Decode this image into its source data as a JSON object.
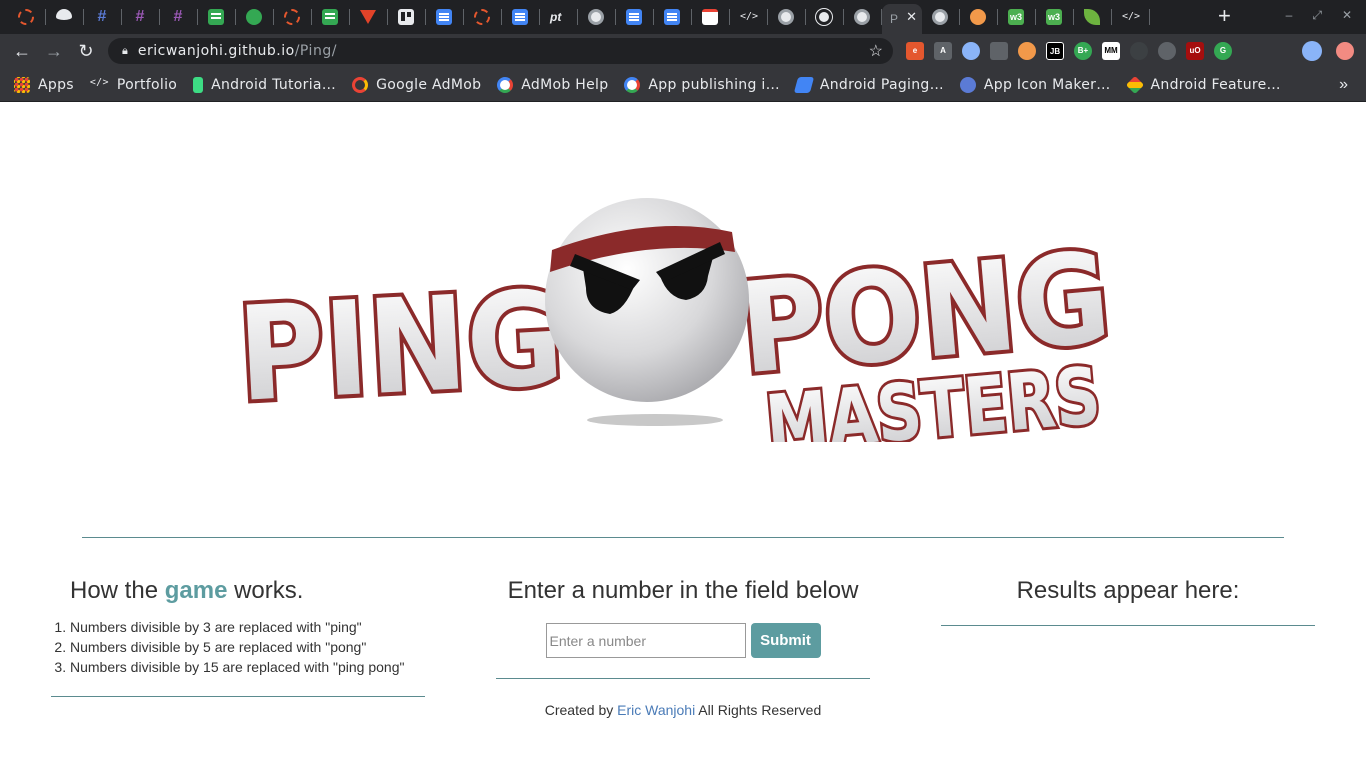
{
  "browser": {
    "tabs": [
      {
        "icon": "ubuntu-ring-icon"
      },
      {
        "icon": "helmet-icon"
      },
      {
        "icon": "slack-icon"
      },
      {
        "icon": "slack-icon"
      },
      {
        "icon": "slack-icon"
      },
      {
        "icon": "sheets-icon"
      },
      {
        "icon": "chat-icon"
      },
      {
        "icon": "ubuntu-ring-icon"
      },
      {
        "icon": "sheets-icon"
      },
      {
        "icon": "gitlab-icon"
      },
      {
        "icon": "trello-icon"
      },
      {
        "icon": "docs-icon"
      },
      {
        "icon": "ubuntu-ring-icon"
      },
      {
        "icon": "docs-icon"
      },
      {
        "icon": "pivotal-icon"
      },
      {
        "icon": "globe-icon"
      },
      {
        "icon": "docs-icon"
      },
      {
        "icon": "docs-icon"
      },
      {
        "icon": "gmail-icon"
      },
      {
        "icon": "code-icon"
      },
      {
        "icon": "globe-icon"
      },
      {
        "icon": "github-icon"
      },
      {
        "icon": "globe-icon"
      }
    ],
    "active_tab": {
      "label": "P"
    },
    "tabs_after": [
      {
        "icon": "globe-icon"
      },
      {
        "icon": "coin-icon"
      },
      {
        "icon": "w3-icon"
      },
      {
        "icon": "w3-icon"
      },
      {
        "icon": "leaf-icon"
      },
      {
        "icon": "code-icon"
      }
    ],
    "url_host": "ericwanjohi.github.io",
    "url_path": "/Ping/",
    "bookmarks": [
      {
        "label": "Apps"
      },
      {
        "label": "Portfolio"
      },
      {
        "label": "Android Tutoria…"
      },
      {
        "label": "Google AdMob"
      },
      {
        "label": "AdMob Help"
      },
      {
        "label": "App publishing i…"
      },
      {
        "label": "Android Paging…"
      },
      {
        "label": "App Icon Maker…"
      },
      {
        "label": "Android Feature…"
      }
    ],
    "more_bookmarks": "»"
  },
  "page": {
    "logo_text": {
      "left": "PING",
      "right": "PONG",
      "sub": "MASTERS"
    },
    "how": {
      "title_pre": "How the ",
      "title_accent": "game",
      "title_post": " works.",
      "rules": [
        "Numbers divisible by 3 are replaced with \"ping\"",
        "Numbers divisible by 5 are replaced with \"pong\"",
        "Numbers divisible by 15 are replaced with \"ping pong\""
      ]
    },
    "input": {
      "title": "Enter a number in the field below",
      "placeholder": "Enter a number",
      "value": "",
      "submit_label": "Submit"
    },
    "credit": {
      "pre": "Created by ",
      "author": "Eric Wanjohi",
      "post": " All Rights Reserved"
    },
    "results": {
      "title": "Results appear here:"
    }
  },
  "colors": {
    "accent": "#5d9ca0",
    "logo_red": "#8b2a2a",
    "link": "#4a7bb7"
  }
}
